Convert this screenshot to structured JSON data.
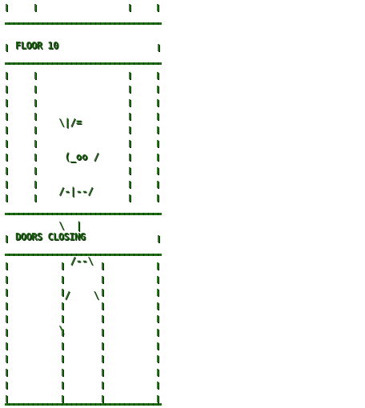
{
  "floor_banner": {
    "text": "FLOOR 10"
  },
  "doors_banner": {
    "text": "DOORS CLOSING"
  },
  "ascii_figure": [
    " \\|/=",
    "  (_oo /",
    " /-|--/",
    " \\  |",
    "   /--\\",
    "  /    \\",
    " \\"
  ],
  "colors": {
    "foreground": "#1e5e14",
    "shadow": "#0a2a06",
    "background": "#ffffff"
  }
}
